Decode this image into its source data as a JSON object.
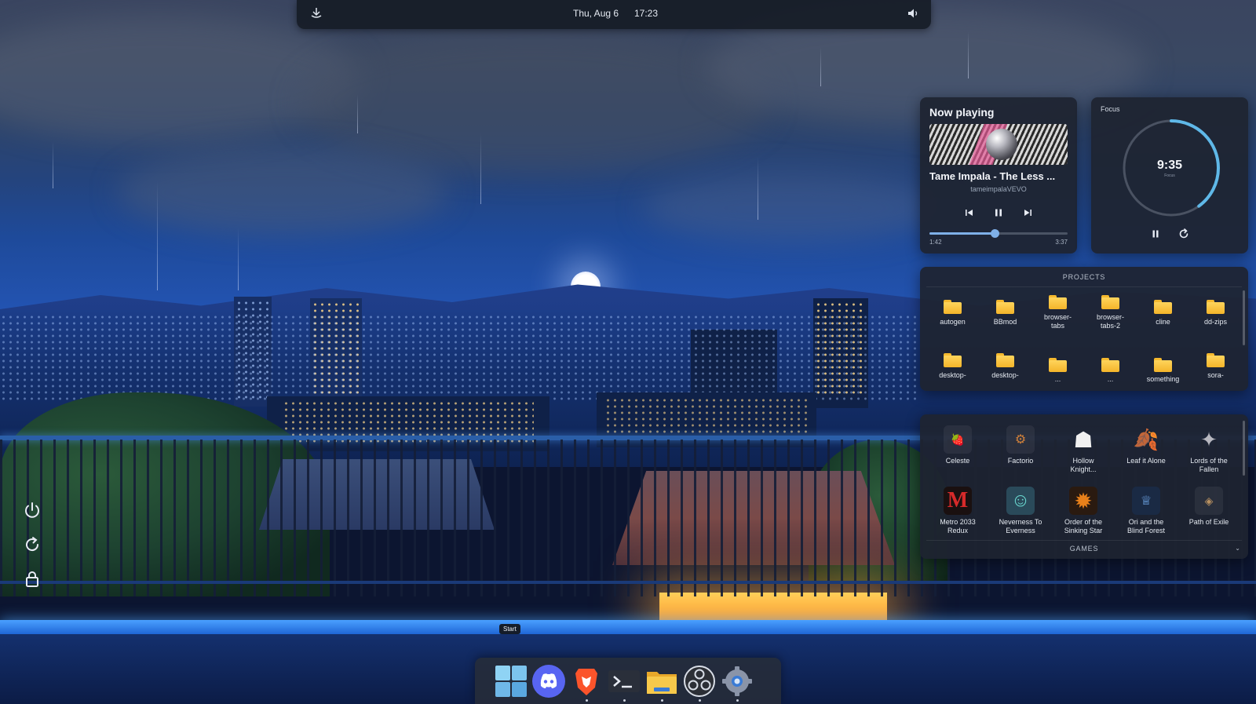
{
  "topbar": {
    "date": "Thu, Aug 6",
    "time": "17:23",
    "left_icon": "tray-icon",
    "volume_icon": "speaker-icon"
  },
  "side_controls": [
    "power-icon",
    "restart-icon",
    "lock-icon"
  ],
  "now_playing": {
    "title": "Now playing",
    "song": "Tame Impala - The Less ...",
    "artist": "tameimpalaVEVO",
    "elapsed": "1:42",
    "duration": "3:37",
    "progress": 0.47,
    "controls": [
      "previous-icon",
      "pause-icon",
      "next-icon"
    ]
  },
  "focus": {
    "label": "Focus",
    "time": "9:35",
    "sub": "Focus",
    "progress": 0.4,
    "controls": [
      "pause-icon",
      "reset-icon"
    ],
    "accent": "#5fb8e8"
  },
  "projects": {
    "header": "PROJECTS",
    "items": [
      {
        "label": "autogen"
      },
      {
        "label": "BBmod"
      },
      {
        "label": "browser-\ntabs"
      },
      {
        "label": "browser-\ntabs-2"
      },
      {
        "label": "cline"
      },
      {
        "label": "dd-zips"
      },
      {
        "label": "desktop-"
      },
      {
        "label": "desktop-"
      },
      {
        "label": "..."
      },
      {
        "label": "..."
      },
      {
        "label": "something"
      },
      {
        "label": "sora-"
      }
    ]
  },
  "games": {
    "footer": "GAMES",
    "items": [
      {
        "label": "Celeste",
        "icon": "celeste-icon",
        "glyph": "🍓",
        "color": "#c23a3a"
      },
      {
        "label": "Factorio",
        "icon": "factorio-icon",
        "glyph": "⚙",
        "color": "#d0803a"
      },
      {
        "label": "Hollow\nKnight...",
        "icon": "hollow-knight-icon",
        "glyph": "☗",
        "color": "#f0f0f0"
      },
      {
        "label": "Leaf it Alone",
        "icon": "leaf-icon",
        "glyph": "🍂",
        "color": "#f0902a"
      },
      {
        "label": "Lords of the\nFallen",
        "icon": "lords-fallen-icon",
        "glyph": "✦",
        "color": "#b8b8c0"
      },
      {
        "label": "Metro 2033\nRedux",
        "icon": "metro-icon",
        "glyph": "M",
        "color": "#d62a2a"
      },
      {
        "label": "Neverness To\nEverness",
        "icon": "neverness-icon",
        "glyph": "☺",
        "color": "#6ad8d0"
      },
      {
        "label": "Order of the\nSinking Star",
        "icon": "order-star-icon",
        "glyph": "✹",
        "color": "#e8801a"
      },
      {
        "label": "Ori and the\nBlind Forest",
        "icon": "ori-icon",
        "glyph": "♕",
        "color": "#7ab8ff"
      },
      {
        "label": "Path of Exile",
        "icon": "path-exile-icon",
        "glyph": "◈",
        "color": "#b89060"
      }
    ]
  },
  "taskbar": {
    "tooltip": "Start",
    "apps": [
      {
        "name": "start-button",
        "color": "#7fc8f0"
      },
      {
        "name": "discord-icon",
        "color": "#5865f2"
      },
      {
        "name": "brave-icon",
        "color": "#fb542b"
      },
      {
        "name": "terminal-icon",
        "color": "#2a2f3a"
      },
      {
        "name": "file-explorer-icon",
        "color": "#f5c043"
      },
      {
        "name": "obs-icon",
        "color": "#2c2f36"
      },
      {
        "name": "settings-icon",
        "color": "#8a94a8"
      }
    ]
  }
}
